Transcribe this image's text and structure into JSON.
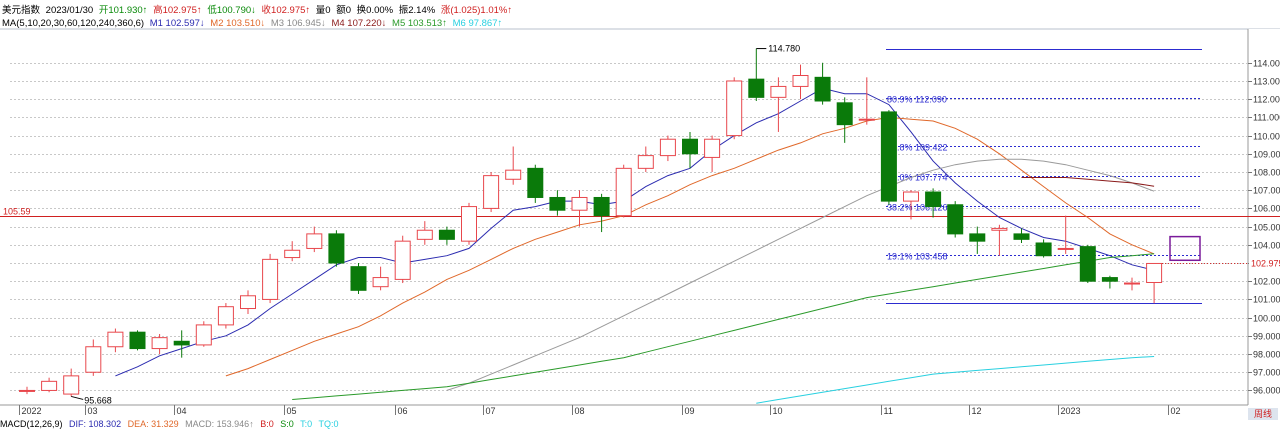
{
  "header": {
    "name": "美元指数",
    "date": "2023/01/30",
    "open": "开101.930↑",
    "high": "高102.975↑",
    "low": "低100.790↓",
    "close": "收102.975↑",
    "volume": "量0",
    "amount": "额0",
    "turnover": "换0.00%",
    "amplitude": "振2.14%",
    "change": "涨(1.025)1.01%↑"
  },
  "ma_line": {
    "title": "MA(5,10,20,30,60,120,240,360,6)",
    "m1": "M1 102.597↓",
    "m2": "M2 103.510↓",
    "m3": "M3 106.945↓",
    "m4": "M4 107.220↓",
    "m5": "M5 103.513↑",
    "m6": "M6 97.867↑"
  },
  "colors": {
    "up": "#e8474c",
    "down": "#0a7a0a",
    "m1": "#2b2bb0",
    "m2": "#e0682a",
    "m3": "#9a9a9a",
    "m4": "#8a1a1a",
    "m5": "#2a9a2a",
    "m6": "#28d0e0",
    "fib": "#2c2cd0",
    "redline": "#d02020"
  },
  "bottom_bar": {
    "macd": "MACD(12,26,9)",
    "dif": "DIF: 108.302",
    "dea": "DEA: 31.329",
    "macd_val": "MACD: 153.946↑",
    "b": "B:0",
    "s": "S:0",
    "t": "T:0",
    "tq": "TQ:0"
  },
  "period_button": "周线",
  "chart_data": {
    "type": "candlestick",
    "ylim": [
      95.2,
      115.8
    ],
    "y_ticks": [
      "96.000",
      "97.000",
      "98.000",
      "99.000",
      "100.000",
      "101.000",
      "102.000",
      "103.000",
      "104.000",
      "105.000",
      "106.000",
      "107.000",
      "108.000",
      "109.000",
      "110.000",
      "111.000",
      "112.000",
      "113.000",
      "114.000"
    ],
    "x_ticks": [
      {
        "i": 0,
        "label": "2022"
      },
      {
        "i": 3,
        "label": "03"
      },
      {
        "i": 7,
        "label": "04"
      },
      {
        "i": 12,
        "label": "05"
      },
      {
        "i": 17,
        "label": "06"
      },
      {
        "i": 21,
        "label": "07"
      },
      {
        "i": 25,
        "label": "08"
      },
      {
        "i": 30,
        "label": "09"
      },
      {
        "i": 34,
        "label": "10"
      },
      {
        "i": 39,
        "label": "11"
      },
      {
        "i": 43,
        "label": "12"
      },
      {
        "i": 47,
        "label": "2023"
      },
      {
        "i": 52,
        "label": "02"
      }
    ],
    "candles": [
      [
        96.0,
        96.0,
        96.2,
        95.8
      ],
      [
        96.0,
        96.5,
        96.7,
        95.9
      ],
      [
        95.8,
        96.8,
        97.2,
        95.67
      ],
      [
        97.0,
        98.4,
        98.8,
        96.8
      ],
      [
        98.4,
        99.2,
        99.4,
        98.1
      ],
      [
        99.2,
        98.3,
        99.3,
        98.2
      ],
      [
        98.3,
        98.9,
        99.1,
        98.0
      ],
      [
        98.7,
        98.5,
        99.3,
        97.8
      ],
      [
        98.5,
        99.6,
        99.8,
        98.4
      ],
      [
        99.6,
        100.6,
        100.8,
        99.4
      ],
      [
        100.5,
        101.2,
        101.5,
        100.2
      ],
      [
        101.0,
        103.2,
        103.5,
        100.8
      ],
      [
        103.3,
        103.7,
        104.2,
        103.1
      ],
      [
        103.8,
        104.6,
        105.0,
        103.6
      ],
      [
        104.6,
        103.0,
        104.8,
        102.8
      ],
      [
        102.8,
        101.5,
        103.0,
        101.3
      ],
      [
        101.7,
        102.2,
        102.8,
        101.5
      ],
      [
        102.1,
        104.2,
        104.5,
        101.9
      ],
      [
        104.3,
        104.8,
        105.3,
        104.0
      ],
      [
        104.8,
        104.3,
        105.0,
        104.0
      ],
      [
        104.2,
        106.1,
        106.3,
        104.0
      ],
      [
        106.0,
        107.8,
        108.0,
        105.8
      ],
      [
        107.6,
        108.1,
        109.4,
        107.3
      ],
      [
        108.2,
        106.6,
        108.4,
        106.3
      ],
      [
        106.6,
        105.9,
        107.0,
        105.6
      ],
      [
        105.9,
        106.6,
        107.0,
        105.0
      ],
      [
        106.6,
        105.6,
        106.8,
        104.7
      ],
      [
        105.6,
        108.2,
        108.4,
        105.5
      ],
      [
        108.2,
        108.9,
        109.4,
        108.0
      ],
      [
        108.9,
        109.8,
        110.0,
        108.6
      ],
      [
        109.8,
        109.0,
        110.2,
        108.2
      ],
      [
        108.8,
        109.8,
        110.0,
        108.0
      ],
      [
        110.0,
        113.0,
        113.2,
        109.8
      ],
      [
        113.1,
        112.1,
        114.78,
        111.9
      ],
      [
        112.1,
        112.7,
        113.2,
        110.2
      ],
      [
        112.7,
        113.3,
        113.9,
        112.0
      ],
      [
        113.2,
        111.9,
        114.0,
        111.7
      ],
      [
        111.8,
        110.6,
        112.1,
        109.6
      ],
      [
        110.9,
        110.9,
        113.2,
        110.6
      ],
      [
        111.3,
        106.4,
        111.4,
        106.2
      ],
      [
        106.4,
        106.9,
        107.0,
        105.4
      ],
      [
        106.9,
        106.1,
        107.1,
        105.5
      ],
      [
        106.2,
        104.6,
        106.4,
        104.4
      ],
      [
        104.6,
        104.2,
        105.0,
        103.5
      ],
      [
        104.8,
        104.9,
        105.1,
        103.4
      ],
      [
        104.6,
        104.3,
        104.9,
        104.1
      ],
      [
        104.1,
        103.4,
        104.3,
        103.3
      ],
      [
        103.8,
        103.8,
        105.6,
        103.5
      ],
      [
        103.9,
        102.0,
        104.0,
        101.9
      ],
      [
        102.2,
        102.0,
        102.3,
        101.6
      ],
      [
        101.9,
        101.9,
        102.2,
        101.5
      ],
      [
        101.93,
        102.975,
        102.975,
        100.79
      ]
    ],
    "ma": {
      "M1": [
        null,
        null,
        null,
        null,
        96.8,
        97.3,
        97.9,
        98.3,
        98.7,
        99.0,
        99.6,
        100.5,
        101.3,
        102.1,
        102.9,
        103.3,
        103.3,
        103.0,
        103.2,
        103.4,
        103.8,
        104.9,
        105.9,
        106.1,
        106.4,
        106.4,
        106.2,
        106.4,
        107.2,
        107.8,
        108.2,
        109.2,
        110.0,
        110.7,
        111.2,
        111.9,
        112.6,
        112.3,
        112.3,
        111.7,
        110.2,
        108.6,
        107.4,
        106.4,
        105.5,
        104.9,
        104.4,
        104.2,
        103.8,
        103.4,
        102.9,
        102.6
      ],
      "M2": [
        null,
        null,
        null,
        null,
        null,
        null,
        null,
        null,
        null,
        96.8,
        97.2,
        97.7,
        98.2,
        98.7,
        99.1,
        99.5,
        100.1,
        100.8,
        101.4,
        102.1,
        102.6,
        103.2,
        103.8,
        104.3,
        104.7,
        105.1,
        105.3,
        105.6,
        106.2,
        106.7,
        107.3,
        107.8,
        108.2,
        108.7,
        109.2,
        109.6,
        110.1,
        110.4,
        110.8,
        111.0,
        110.9,
        110.8,
        110.4,
        109.8,
        109.0,
        108.1,
        107.2,
        106.3,
        105.5,
        104.6,
        104.0,
        103.5
      ],
      "M3": [
        null,
        null,
        null,
        null,
        null,
        null,
        null,
        null,
        null,
        null,
        null,
        null,
        null,
        null,
        null,
        null,
        null,
        null,
        null,
        96.0,
        96.4,
        96.9,
        97.4,
        97.9,
        98.4,
        98.9,
        99.5,
        100.1,
        100.7,
        101.3,
        101.9,
        102.5,
        103.1,
        103.7,
        104.3,
        104.9,
        105.5,
        106.1,
        106.7,
        107.2,
        107.7,
        108.1,
        108.4,
        108.6,
        108.7,
        108.7,
        108.6,
        108.4,
        108.1,
        107.8,
        107.4,
        106.945
      ],
      "M4": [
        null,
        null,
        null,
        null,
        null,
        null,
        null,
        null,
        null,
        null,
        null,
        null,
        null,
        null,
        null,
        null,
        null,
        null,
        null,
        null,
        null,
        null,
        null,
        null,
        null,
        null,
        null,
        null,
        null,
        null,
        null,
        null,
        null,
        null,
        null,
        null,
        null,
        null,
        null,
        null,
        null,
        null,
        null,
        null,
        null,
        107.7,
        107.7,
        107.7,
        107.6,
        107.5,
        107.4,
        107.22
      ],
      "M5": [
        null,
        null,
        null,
        null,
        null,
        null,
        null,
        null,
        null,
        null,
        null,
        null,
        95.5,
        95.6,
        95.7,
        95.8,
        95.9,
        96.0,
        96.1,
        96.2,
        96.4,
        96.6,
        96.8,
        97.0,
        97.2,
        97.4,
        97.6,
        97.8,
        98.1,
        98.4,
        98.7,
        99.0,
        99.3,
        99.6,
        99.9,
        100.2,
        100.5,
        100.8,
        101.1,
        101.3,
        101.5,
        101.7,
        101.9,
        102.1,
        102.3,
        102.5,
        102.7,
        102.9,
        103.1,
        103.3,
        103.4,
        103.513
      ],
      "M6": [
        null,
        null,
        null,
        null,
        null,
        null,
        null,
        null,
        null,
        null,
        null,
        null,
        null,
        null,
        null,
        null,
        null,
        null,
        null,
        null,
        null,
        null,
        null,
        null,
        null,
        null,
        null,
        null,
        null,
        null,
        null,
        null,
        null,
        95.3,
        95.5,
        95.7,
        95.9,
        96.1,
        96.3,
        96.5,
        96.7,
        96.9,
        97.0,
        97.1,
        97.2,
        97.3,
        97.4,
        97.5,
        97.6,
        97.7,
        97.8,
        97.867
      ]
    },
    "annotations": {
      "high_label": "114.780",
      "low_label": "95.668",
      "horizontal_line_value": 105.59,
      "horizontal_line_label": "105.59",
      "last_price_label": "102.975"
    },
    "fibonacci": [
      {
        "value": 114.78,
        "label": "",
        "solid": true
      },
      {
        "value": 112.09,
        "label": "80.9% 112.090",
        "solid": false
      },
      {
        "value": 109.422,
        "label": "61.8% 109.422",
        "solid": false
      },
      {
        "value": 107.774,
        "label": "50.0% 107.774",
        "solid": false
      },
      {
        "value": 106.126,
        "label": "38.2% 106.126",
        "solid": false
      },
      {
        "value": 103.458,
        "label": "19.1% 103.458",
        "solid": false
      },
      {
        "value": 100.79,
        "label": "",
        "solid": true
      }
    ],
    "box": {
      "y_top": 104.45,
      "y_bottom": 103.15
    }
  }
}
